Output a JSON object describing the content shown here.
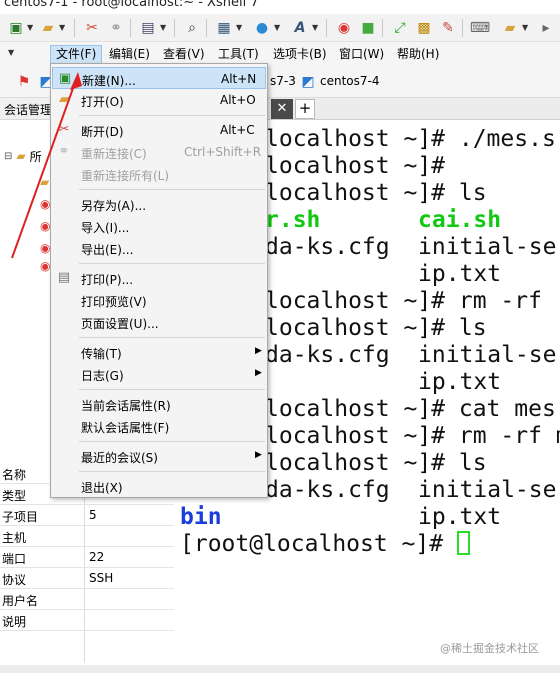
{
  "window": {
    "title": "centos7-1 - root@localhost:~ - Xshell 7"
  },
  "menubar": {
    "items": [
      {
        "id": "file",
        "label": "文件(F)"
      },
      {
        "id": "edit",
        "label": "编辑(E)"
      },
      {
        "id": "view",
        "label": "查看(V)"
      },
      {
        "id": "tools",
        "label": "工具(T)"
      },
      {
        "id": "tabs",
        "label": "选项卡(B)"
      },
      {
        "id": "window",
        "label": "窗口(W)"
      },
      {
        "id": "help",
        "label": "帮助(H)"
      }
    ]
  },
  "quickbar": {
    "session1": "s7-3",
    "session2": "centos7-4"
  },
  "left_pane": {
    "title": "会话管理",
    "root_label": "所"
  },
  "file_menu": {
    "new": {
      "label": "新建(N)...",
      "shortcut": "Alt+N"
    },
    "open": {
      "label": "打开(O)",
      "shortcut": "Alt+O"
    },
    "disconnect": {
      "label": "断开(D)",
      "shortcut": "Alt+C"
    },
    "reconnect": {
      "label": "重新连接(C)",
      "shortcut": "Ctrl+Shift+R"
    },
    "reconnect_all": {
      "label": "重新连接所有(L)"
    },
    "save_as": {
      "label": "另存为(A)..."
    },
    "import": {
      "label": "导入(I)..."
    },
    "export": {
      "label": "导出(E)..."
    },
    "print": {
      "label": "打印(P)..."
    },
    "print_preview": {
      "label": "打印预览(V)"
    },
    "page_setup": {
      "label": "页面设置(U)..."
    },
    "transfer": {
      "label": "传输(T)"
    },
    "log": {
      "label": "日志(G)"
    },
    "session_props": {
      "label": "当前会话属性(R)"
    },
    "default_props": {
      "label": "默认会话属性(F)"
    },
    "recent": {
      "label": "最近的会议(S)"
    },
    "exit": {
      "label": "退出(X)"
    }
  },
  "properties": {
    "rows": [
      {
        "key": "名称",
        "value": ""
      },
      {
        "key": "类型",
        "value": ""
      },
      {
        "key": "子项目",
        "value": "5"
      },
      {
        "key": "主机",
        "value": ""
      },
      {
        "key": "端口",
        "value": "22"
      },
      {
        "key": "协议",
        "value": "SSH"
      },
      {
        "key": "用户名",
        "value": ""
      },
      {
        "key": "说明",
        "value": ""
      }
    ]
  },
  "terminal": {
    "lines": [
      "localhost ~]# ./mes.s",
      "localhost ~]#",
      "localhost ~]# ls",
      "r.sh",
      "cai.sh",
      "da-ks.cfg",
      "initial-se",
      "ip.txt",
      "localhost ~]# rm -rf",
      "localhost ~]# ls",
      "da-ks.cfg",
      "initial-se",
      "ip.txt",
      "localhost ~]# cat mes",
      "localhost ~]# rm -rf m",
      "localhost ~]# ls",
      "da-ks.cfg",
      "initial-se",
      "bin",
      "ip.txt",
      "[root@localhost ~]# "
    ]
  },
  "watermark": "@稀土掘金技术社区",
  "colors": {
    "accent": "#cde3f7",
    "terminal_green": "#12c912",
    "terminal_blue": "#1a3de0",
    "arrow": "#e02020"
  }
}
